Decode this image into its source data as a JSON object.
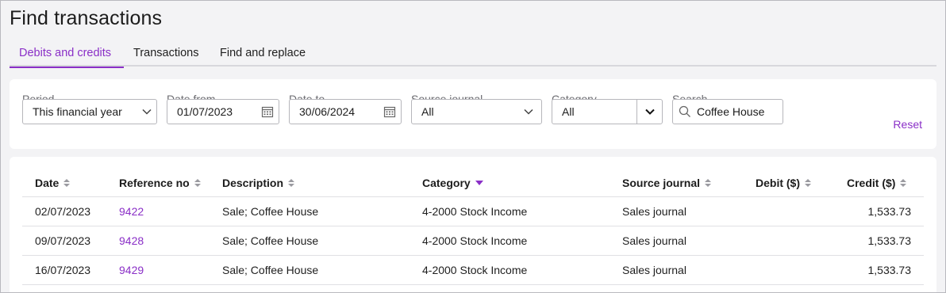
{
  "page": {
    "title": "Find transactions"
  },
  "tabs": [
    {
      "label": "Debits and credits",
      "active": true
    },
    {
      "label": "Transactions",
      "active": false
    },
    {
      "label": "Find and replace",
      "active": false
    }
  ],
  "filters": {
    "period": {
      "label": "Period",
      "value": "This financial year"
    },
    "date_from": {
      "label": "Date from",
      "value": "01/07/2023"
    },
    "date_to": {
      "label": "Date to",
      "value": "30/06/2024"
    },
    "source_journal": {
      "label": "Source journal",
      "value": "All"
    },
    "category": {
      "label": "Category",
      "value": "All"
    },
    "search": {
      "label": "Search",
      "value": "Coffee House"
    },
    "reset_label": "Reset"
  },
  "table": {
    "columns": [
      "Date",
      "Reference no",
      "Description",
      "Category",
      "Source journal",
      "Debit ($)",
      "Credit ($)"
    ],
    "sorted_column": "Category",
    "rows": [
      {
        "date": "02/07/2023",
        "ref": "9422",
        "description": "Sale; Coffee House",
        "category": "4-2000 Stock Income",
        "journal": "Sales journal",
        "debit": "",
        "credit": "1,533.73"
      },
      {
        "date": "09/07/2023",
        "ref": "9428",
        "description": "Sale; Coffee House",
        "category": "4-2000 Stock Income",
        "journal": "Sales journal",
        "debit": "",
        "credit": "1,533.73"
      },
      {
        "date": "16/07/2023",
        "ref": "9429",
        "description": "Sale; Coffee House",
        "category": "4-2000 Stock Income",
        "journal": "Sales journal",
        "debit": "",
        "credit": "1,533.73"
      }
    ]
  },
  "colors": {
    "accent": "#8a2fc7",
    "background": "#f3f3f5",
    "card": "#ffffff"
  }
}
